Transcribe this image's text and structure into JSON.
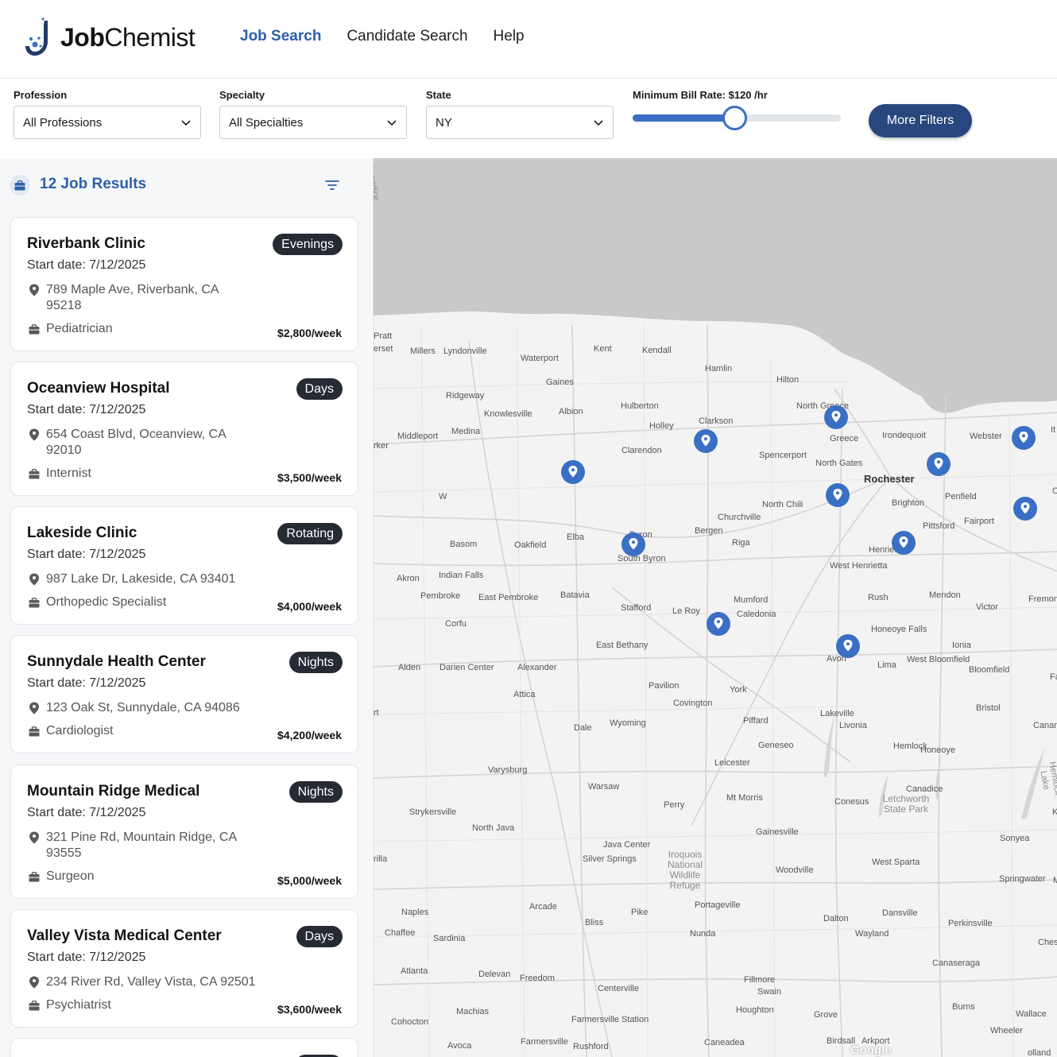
{
  "brand": {
    "name_bold": "Job",
    "name_regular": "Chemist"
  },
  "nav": {
    "items": [
      {
        "label": "Job Search",
        "active": true
      },
      {
        "label": "Candidate Search",
        "active": false
      },
      {
        "label": "Help",
        "active": false
      }
    ]
  },
  "filters": {
    "profession": {
      "label": "Profession",
      "value": "All Professions"
    },
    "specialty": {
      "label": "Specialty",
      "value": "All Specialties"
    },
    "state": {
      "label": "State",
      "value": "NY"
    },
    "bill_rate": {
      "label": "Minimum Bill Rate: $120 /hr",
      "fraction": 0.49
    },
    "more_filters": "More Filters"
  },
  "results": {
    "title": "12 Job Results",
    "jobs": [
      {
        "name": "Riverbank Clinic",
        "shift": "Evenings",
        "start": "Start date: 7/12/2025",
        "address": "789 Maple Ave, Riverbank, CA 95218",
        "specialty": "Pediatrician",
        "pay": "$2,800/week"
      },
      {
        "name": "Oceanview Hospital",
        "shift": "Days",
        "start": "Start date: 7/12/2025",
        "address": "654 Coast Blvd, Oceanview, CA 92010",
        "specialty": "Internist",
        "pay": "$3,500/week"
      },
      {
        "name": "Lakeside Clinic",
        "shift": "Rotating",
        "start": "Start date: 7/12/2025",
        "address": "987 Lake Dr, Lakeside, CA 93401",
        "specialty": "Orthopedic Specialist",
        "pay": "$4,000/week"
      },
      {
        "name": "Sunnydale Health Center",
        "shift": "Nights",
        "start": "Start date: 7/12/2025",
        "address": "123 Oak St, Sunnydale, CA 94086",
        "specialty": "Cardiologist",
        "pay": "$4,200/week"
      },
      {
        "name": "Mountain Ridge Medical",
        "shift": "Nights",
        "start": "Start date: 7/12/2025",
        "address": "321 Pine Rd, Mountain Ridge, CA 93555",
        "specialty": "Surgeon",
        "pay": "$5,000/week"
      },
      {
        "name": "Valley Vista Medical Center",
        "shift": "Days",
        "start": "Start date: 7/12/2025",
        "address": "234 River Rd, Valley Vista, CA 92501",
        "specialty": "Psychiatrist",
        "pay": "$3,600/week"
      }
    ]
  },
  "map": {
    "credit": "Google",
    "places": [
      {
        "name": "Rochester",
        "big": true
      },
      {
        "name": "Greece"
      },
      {
        "name": "North Greece"
      },
      {
        "name": "Irondequoit"
      },
      {
        "name": "Webster"
      },
      {
        "name": "North Gates"
      },
      {
        "name": "Spencerport"
      },
      {
        "name": "Brighton"
      },
      {
        "name": "Penfield"
      },
      {
        "name": "Fairport"
      },
      {
        "name": "Pittsford"
      },
      {
        "name": "North Chili"
      },
      {
        "name": "Churchville"
      },
      {
        "name": "Bergen"
      },
      {
        "name": "Riga"
      },
      {
        "name": "Henrietta"
      },
      {
        "name": "West Henrietta"
      },
      {
        "name": "Rush"
      },
      {
        "name": "Mendon"
      },
      {
        "name": "Victor"
      },
      {
        "name": "Honeoye Falls"
      },
      {
        "name": "Ionia"
      },
      {
        "name": "Lima"
      },
      {
        "name": "West Bloomfield"
      },
      {
        "name": "Bloomfield"
      },
      {
        "name": "Avon"
      },
      {
        "name": "Mumford"
      },
      {
        "name": "Caledonia"
      },
      {
        "name": "Le Roy"
      },
      {
        "name": "Stafford"
      },
      {
        "name": "Batavia"
      },
      {
        "name": "Elba"
      },
      {
        "name": "Oakfield"
      },
      {
        "name": "Basom"
      },
      {
        "name": "South Byron"
      },
      {
        "name": "Byron"
      },
      {
        "name": "Clarendon"
      },
      {
        "name": "Holley"
      },
      {
        "name": "Clarkson"
      },
      {
        "name": "Hamlin"
      },
      {
        "name": "Hilton"
      },
      {
        "name": "Kendall"
      },
      {
        "name": "Kent"
      },
      {
        "name": "Waterport"
      },
      {
        "name": "Gaines"
      },
      {
        "name": "Albion"
      },
      {
        "name": "Hulberton"
      },
      {
        "name": "Knowlesville"
      },
      {
        "name": "Ridgeway"
      },
      {
        "name": "Medina"
      },
      {
        "name": "Middleport"
      },
      {
        "name": "Millers"
      },
      {
        "name": "Lyndonville"
      },
      {
        "name": "Akron"
      },
      {
        "name": "Indian Falls"
      },
      {
        "name": "Pembroke"
      },
      {
        "name": "East Pembroke"
      },
      {
        "name": "Corfu"
      },
      {
        "name": "Alden"
      },
      {
        "name": "Darien Center"
      },
      {
        "name": "Alexander"
      },
      {
        "name": "East Bethany"
      },
      {
        "name": "Attica"
      },
      {
        "name": "Pavilion"
      },
      {
        "name": "Covington"
      },
      {
        "name": "York"
      },
      {
        "name": "Wyoming"
      },
      {
        "name": "Piffard"
      },
      {
        "name": "Geneseo"
      },
      {
        "name": "Dale"
      },
      {
        "name": "Lakeville"
      },
      {
        "name": "Livonia"
      },
      {
        "name": "Hemlock"
      },
      {
        "name": "Honeoye"
      },
      {
        "name": "Bristol"
      },
      {
        "name": "Leicester"
      },
      {
        "name": "Varysburg"
      },
      {
        "name": "Warsaw"
      },
      {
        "name": "Mt Morris"
      },
      {
        "name": "Perry"
      },
      {
        "name": "Conesus"
      },
      {
        "name": "Canadice"
      },
      {
        "name": "Strykersville"
      },
      {
        "name": "North Java"
      },
      {
        "name": "Java Center"
      },
      {
        "name": "Silver Springs"
      },
      {
        "name": "Gainesville"
      },
      {
        "name": "Sonyea"
      },
      {
        "name": "Woodville"
      },
      {
        "name": "West Sparta"
      },
      {
        "name": "Springwater"
      },
      {
        "name": "Naples"
      },
      {
        "name": "Chaffee"
      },
      {
        "name": "Sardinia"
      },
      {
        "name": "Arcade"
      },
      {
        "name": "Bliss"
      },
      {
        "name": "Pike"
      },
      {
        "name": "Portageville"
      },
      {
        "name": "Nunda"
      },
      {
        "name": "Dalton"
      },
      {
        "name": "Dansville"
      },
      {
        "name": "Wayland"
      },
      {
        "name": "Perkinsville"
      },
      {
        "name": "Atlanta"
      },
      {
        "name": "Delevan"
      },
      {
        "name": "Freedom"
      },
      {
        "name": "Centerville"
      },
      {
        "name": "Fillmore"
      },
      {
        "name": "Swain"
      },
      {
        "name": "Canaseraga"
      },
      {
        "name": "Cohocton"
      },
      {
        "name": "Machias"
      },
      {
        "name": "Farmersville Station"
      },
      {
        "name": "Houghton"
      },
      {
        "name": "Grove"
      },
      {
        "name": "Burns"
      },
      {
        "name": "Wallace"
      },
      {
        "name": "Wheeler"
      },
      {
        "name": "Avoca"
      },
      {
        "name": "Farmersville"
      },
      {
        "name": "Rushford"
      },
      {
        "name": "Caneadea"
      },
      {
        "name": "Birdsall"
      },
      {
        "name": "Arkport"
      },
      {
        "name": "Fremont"
      },
      {
        "name": "Farmingto"
      },
      {
        "name": "Canan"
      },
      {
        "name": "Cheshire"
      },
      {
        "name": "Pratt"
      },
      {
        "name": "erset"
      },
      {
        "name": "rker"
      },
      {
        "name": "rt"
      },
      {
        "name": "rilla"
      },
      {
        "name": "olland"
      },
      {
        "name": "Kanona"
      },
      {
        "name": "M"
      },
      {
        "name": "It"
      },
      {
        "name": "O"
      },
      {
        "name": "W"
      },
      {
        "name": "Iroquois National Wildlife Refuge",
        "park": true
      },
      {
        "name": "Letchworth State Park",
        "park": true
      },
      {
        "name": "Hemlock Lake",
        "park": true
      },
      {
        "name": "Canadice",
        "park": true
      }
    ],
    "marker_count": 11
  }
}
